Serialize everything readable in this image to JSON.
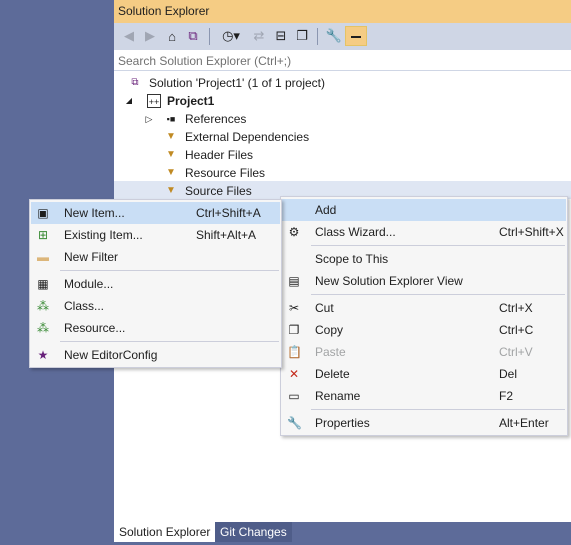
{
  "panel": {
    "title": "Solution Explorer",
    "search_placeholder": "Search Solution Explorer (Ctrl+;)"
  },
  "toolbar": {
    "icons": [
      "back-icon",
      "forward-icon",
      "home-icon",
      "switch-views-icon",
      "pending-changes-icon",
      "sync-icon",
      "collapse-all-icon",
      "show-all-files-icon",
      "properties-wrench-icon",
      "preview-selected-icon"
    ]
  },
  "tree": {
    "solution": "Solution 'Project1' (1 of 1 project)",
    "project": "Project1",
    "items": [
      "References",
      "External Dependencies",
      "Header Files",
      "Resource Files",
      "Source Files"
    ]
  },
  "tabs": {
    "solution_explorer": "Solution Explorer",
    "git_changes": "Git Changes"
  },
  "context_menu": {
    "add": "Add",
    "class_wizard": "Class Wizard...",
    "class_wizard_sc": "Ctrl+Shift+X",
    "scope": "Scope to This",
    "new_view": "New Solution Explorer View",
    "cut": "Cut",
    "cut_sc": "Ctrl+X",
    "copy": "Copy",
    "copy_sc": "Ctrl+C",
    "paste": "Paste",
    "paste_sc": "Ctrl+V",
    "delete": "Delete",
    "delete_sc": "Del",
    "rename": "Rename",
    "rename_sc": "F2",
    "properties": "Properties",
    "properties_sc": "Alt+Enter"
  },
  "submenu": {
    "new_item": "New Item...",
    "new_item_sc": "Ctrl+Shift+A",
    "existing_item": "Existing Item...",
    "existing_item_sc": "Shift+Alt+A",
    "new_filter": "New Filter",
    "module": "Module...",
    "class": "Class...",
    "resource": "Resource...",
    "editorconfig": "New EditorConfig"
  },
  "colors": {
    "title_bar": "#f5cc84",
    "toolbar": "#cfd6e5",
    "background": "#5d6b99",
    "highlight": "#c9def5",
    "selected_row": "#dfe6f3"
  }
}
